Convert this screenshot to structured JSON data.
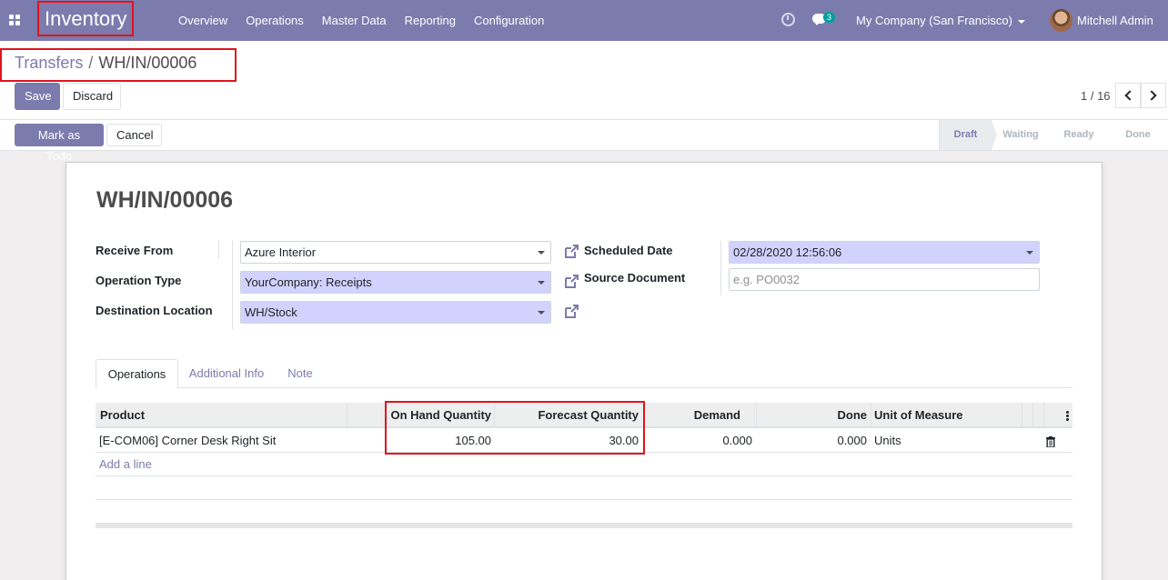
{
  "navbar": {
    "app_name": "Inventory",
    "menu": [
      "Overview",
      "Operations",
      "Master Data",
      "Reporting",
      "Configuration"
    ],
    "chat_badge": "3",
    "company": "My Company (San Francisco)",
    "user": "Mitchell Admin",
    "colors": {
      "brand": "#7c7bad",
      "highlight": "#e0141e",
      "badge": "#00a09d"
    }
  },
  "breadcrumb": {
    "parent": "Transfers",
    "separator": "/",
    "current": "WH/IN/00006"
  },
  "actions": {
    "save": "Save",
    "discard": "Discard"
  },
  "pager": {
    "value": "1 / 16"
  },
  "statusbar": {
    "buttons": [
      "Mark as Todo",
      "Cancel"
    ],
    "stages": [
      "Draft",
      "Waiting",
      "Ready",
      "Done"
    ],
    "active_stage": "Draft"
  },
  "form": {
    "title": "WH/IN/00006",
    "receive_from_label": "Receive From",
    "receive_from_value": "Azure Interior",
    "operation_type_label": "Operation Type",
    "operation_type_value": "YourCompany: Receipts",
    "destination_label": "Destination Location",
    "destination_value": "WH/Stock",
    "scheduled_date_label": "Scheduled Date",
    "scheduled_date_value": "02/28/2020 12:56:06",
    "source_document_label": "Source Document",
    "source_document_placeholder": "e.g. PO0032"
  },
  "tabs": [
    "Operations",
    "Additional Info",
    "Note"
  ],
  "table": {
    "columns": [
      "Product",
      "On Hand Quantity",
      "Forecast Quantity",
      "Demand",
      "Done",
      "Unit of Measure"
    ],
    "rows": [
      {
        "product": "[E-COM06] Corner Desk Right Sit",
        "on_hand": "105.00",
        "forecast": "30.00",
        "demand": "0.000",
        "done": "0.000",
        "uom": "Units"
      }
    ],
    "add_line": "Add a line"
  }
}
